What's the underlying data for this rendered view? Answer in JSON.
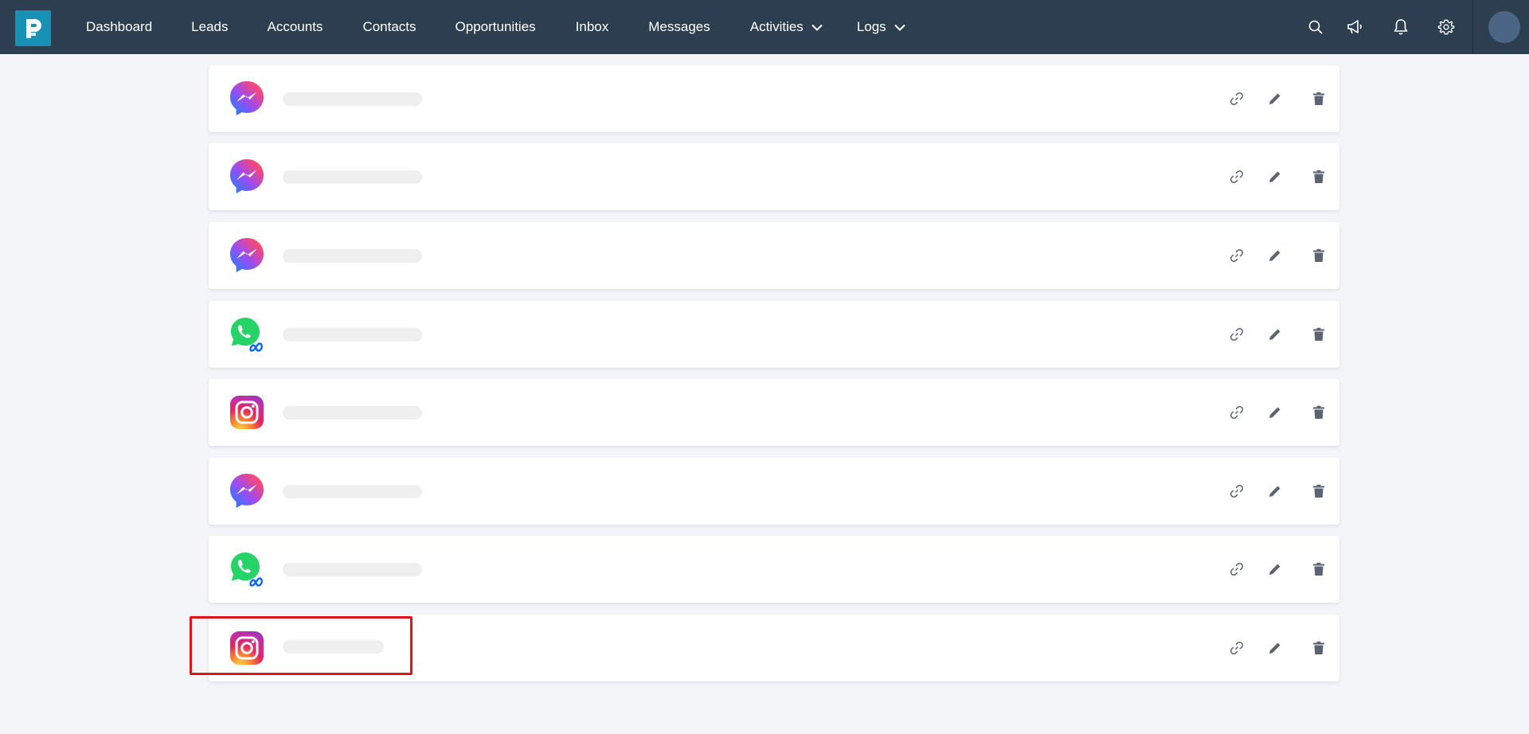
{
  "nav": {
    "items": [
      {
        "label": "Dashboard"
      },
      {
        "label": "Leads"
      },
      {
        "label": "Accounts"
      },
      {
        "label": "Contacts"
      },
      {
        "label": "Opportunities"
      },
      {
        "label": "Inbox"
      },
      {
        "label": "Messages"
      },
      {
        "label": "Activities",
        "dropdown": true
      },
      {
        "label": "Logs",
        "dropdown": true
      }
    ]
  },
  "toolbar_icons": [
    "search-icon",
    "megaphone-icon",
    "bell-icon",
    "gear-icon"
  ],
  "colors": {
    "topbar": "#2d3e50",
    "logo": "#1791b5",
    "action_icon": "#5b6470",
    "highlight": "#e0141b"
  },
  "channels": [
    {
      "type": "messenger",
      "name": ""
    },
    {
      "type": "messenger",
      "name": ""
    },
    {
      "type": "messenger",
      "name": ""
    },
    {
      "type": "whatsapp",
      "name": ""
    },
    {
      "type": "instagram",
      "name": ""
    },
    {
      "type": "messenger",
      "name": ""
    },
    {
      "type": "whatsapp",
      "name": ""
    },
    {
      "type": "instagram",
      "name": "",
      "highlighted": true
    }
  ]
}
